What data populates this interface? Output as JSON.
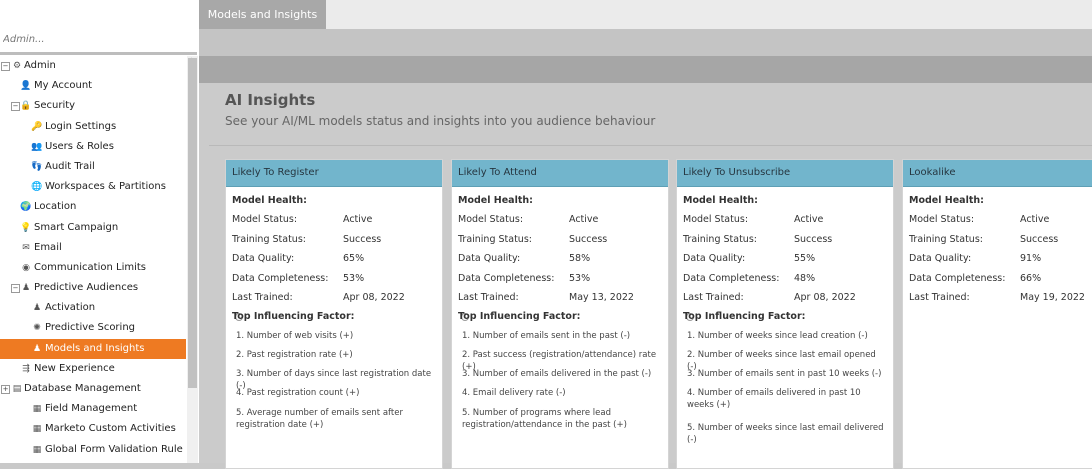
{
  "search": {
    "placeholder": "Admin..."
  },
  "sidebar": {
    "items": [
      {
        "label": "Admin",
        "icon": "gear-icon",
        "glyph": "⚙",
        "level": 0,
        "expander": "⊟"
      },
      {
        "label": "My Account",
        "icon": "user-icon",
        "glyph": "👤",
        "level": 1
      },
      {
        "label": "Security",
        "icon": "lock-icon",
        "glyph": "🔒",
        "level": 1,
        "expander": "⊟"
      },
      {
        "label": "Login Settings",
        "icon": "key-icon",
        "glyph": "🔑",
        "level": 2
      },
      {
        "label": "Users & Roles",
        "icon": "users-icon",
        "glyph": "👥",
        "level": 2
      },
      {
        "label": "Audit Trail",
        "icon": "footprints-icon",
        "glyph": "👣",
        "level": 2
      },
      {
        "label": "Workspaces & Partitions",
        "icon": "globe-icon",
        "glyph": "🌐",
        "level": 2
      },
      {
        "label": "Location",
        "icon": "location-icon",
        "glyph": "🌍",
        "level": 1
      },
      {
        "label": "Smart Campaign",
        "icon": "lightbulb-icon",
        "glyph": "💡",
        "level": 1
      },
      {
        "label": "Email",
        "icon": "email-icon",
        "glyph": "✉",
        "level": 1
      },
      {
        "label": "Communication Limits",
        "icon": "limits-icon",
        "glyph": "◉",
        "level": 1
      },
      {
        "label": "Predictive Audiences",
        "icon": "audience-icon",
        "glyph": "♟",
        "level": 1,
        "expander": "⊟"
      },
      {
        "label": "Activation",
        "icon": "activation-icon",
        "glyph": "♟",
        "level": 2
      },
      {
        "label": "Predictive Scoring",
        "icon": "scoring-icon",
        "glyph": "✺",
        "level": 2
      },
      {
        "label": "Models and Insights",
        "icon": "insights-icon",
        "glyph": "♟",
        "level": 2,
        "selected": true
      },
      {
        "label": "New Experience",
        "icon": "experience-icon",
        "glyph": "⇶",
        "level": 1
      },
      {
        "label": "Database Management",
        "icon": "database-icon",
        "glyph": "▤",
        "level": 0,
        "expander": "⊞"
      },
      {
        "label": "Field Management",
        "icon": "field-icon",
        "glyph": "▦",
        "level": 2
      },
      {
        "label": "Marketo Custom Activities",
        "icon": "activities-icon",
        "glyph": "▦",
        "level": 2
      },
      {
        "label": "Global Form Validation Rule",
        "icon": "form-rule-icon",
        "glyph": "▦",
        "level": 2
      }
    ]
  },
  "tabs": [
    {
      "label": "Models and Insights"
    }
  ],
  "main": {
    "title": "AI Insights",
    "subtitle": "See your AI/ML models status and insights into you audience behaviour"
  },
  "labels": {
    "model_health": "Model Health:",
    "model_status": "Model Status:",
    "training_status": "Training Status:",
    "data_quality": "Data Quality:",
    "data_completeness": "Data Completeness:",
    "last_trained": "Last Trained:",
    "top_factor": "Top Influencing Factor:"
  },
  "cards": [
    {
      "title": "Likely To Register",
      "model_status": "Active",
      "training_status": "Success",
      "data_quality": "65%",
      "data_completeness": "53%",
      "last_trained": "Apr 08, 2022",
      "factors": [
        "1. Number of web visits (+)",
        "2. Past registration rate (+)",
        "3. Number of days since last registration date (-)",
        "4. Past registration count (+)",
        "5. Average number of emails sent after registration date (+)"
      ]
    },
    {
      "title": "Likely To Attend",
      "model_status": "Active",
      "training_status": "Success",
      "data_quality": "58%",
      "data_completeness": "53%",
      "last_trained": "May 13, 2022",
      "factors": [
        "1. Number of emails sent in the past (-)",
        "2. Past success (registration/attendance) rate (+)",
        "3. Number of emails delivered in the past (-)",
        "4. Email delivery rate (-)",
        "5. Number of programs where lead registration/attendance in the past (+)"
      ]
    },
    {
      "title": "Likely To Unsubscribe",
      "model_status": "Active",
      "training_status": "Success",
      "data_quality": "55%",
      "data_completeness": "48%",
      "last_trained": "Apr 08, 2022",
      "factors": [
        "1. Number of weeks since lead creation (-)",
        "2. Number of weeks since last email opened (-)",
        "3. Number of emails sent in past 10 weeks (-)",
        "4. Number of emails delivered in past 10 weeks (+)",
        "5. Number of weeks since last email delivered (-)"
      ]
    },
    {
      "title": "Lookalike",
      "model_status": "Active",
      "training_status": "Success",
      "data_quality": "91%",
      "data_completeness": "66%",
      "last_trained": "May 19, 2022",
      "factors": []
    }
  ]
}
